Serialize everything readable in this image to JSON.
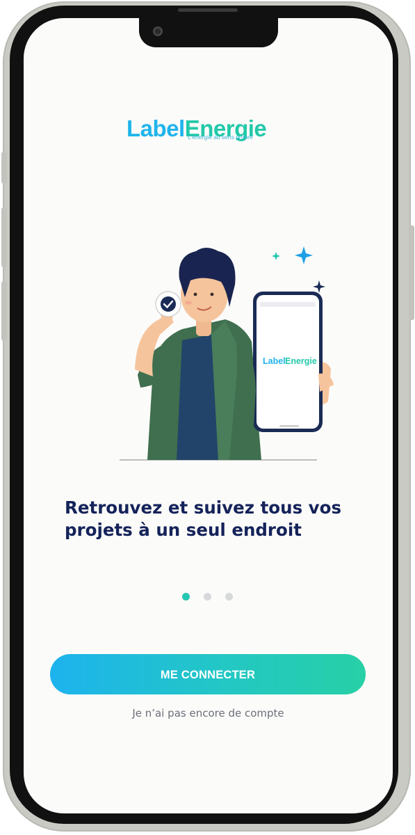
{
  "brand": {
    "logo_part1": "Label",
    "logo_part2": "Energie",
    "tagline": "L'energie au sens propre",
    "color_blue": "#1fb4ec",
    "color_green": "#22c9a9"
  },
  "illustration": {
    "phone_logo_part1": "Label",
    "phone_logo_part2": "Energie",
    "icons": [
      "check-icon",
      "sparkle-icon"
    ]
  },
  "onboarding": {
    "heading_line1": "Retrouvez et suivez tous vos",
    "heading_line2": "projets à un seul endroit",
    "page_count": 3,
    "active_page": 1
  },
  "actions": {
    "login_label": "ME CONNECTER",
    "signup_link": "Je n’ai pas encore de compte"
  },
  "colors": {
    "heading": "#15235a",
    "dot_active": "#27c6b0",
    "dot_inactive": "#d7d8da"
  }
}
